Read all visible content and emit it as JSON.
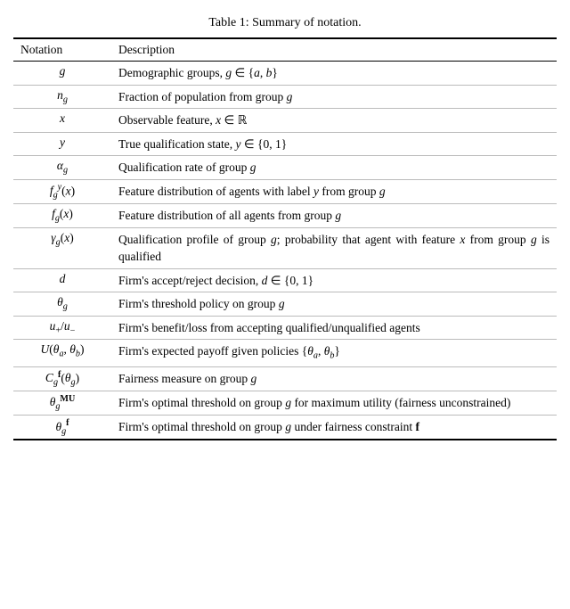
{
  "title": "Table 1: Summary of notation.",
  "columns": [
    "Notation",
    "Description"
  ],
  "rows": [
    {
      "notation_html": "<i>g</i>",
      "description_html": "Demographic groups, <i>g</i> ∈ {<i>a</i>, <i>b</i>}"
    },
    {
      "notation_html": "<i>n<sub>g</sub></i>",
      "description_html": "Fraction of population from group <i>g</i>"
    },
    {
      "notation_html": "<i>x</i>",
      "description_html": "Observable feature, <i>x</i> ∈ ℝ"
    },
    {
      "notation_html": "<i>y</i>",
      "description_html": "True qualification state, <i>y</i> ∈ {0, 1}"
    },
    {
      "notation_html": "<i>α<sub>g</sub></i>",
      "description_html": "Qualification rate of group <i>g</i>"
    },
    {
      "notation_html": "<i>f<sub>g</sub><sup>y</sup></i>(<i>x</i>)",
      "description_html": "Feature distribution of agents with label <i>y</i> from group <i>g</i>"
    },
    {
      "notation_html": "<i>f<sub>g</sub></i>(<i>x</i>)",
      "description_html": "Feature distribution of all agents from group <i>g</i>"
    },
    {
      "notation_html": "<i>γ<sub>g</sub></i>(<i>x</i>)",
      "description_html": "Qualification profile of group <i>g</i>; probability that agent with feature <i>x</i> from group <i>g</i> is qualified"
    },
    {
      "notation_html": "<i>d</i>",
      "description_html": "Firm's accept/reject decision, <i>d</i> ∈ {0, 1}"
    },
    {
      "notation_html": "<i>θ<sub>g</sub></i>",
      "description_html": "Firm's threshold policy on group <i>g</i>"
    },
    {
      "notation_html": "<i>u</i><sub>+</sub>/<i>u</i><sub>−</sub>",
      "description_html": "Firm's benefit/loss from accepting qualified/unqualified agents"
    },
    {
      "notation_html": "<i>U</i>(<i>θ<sub>a</sub></i>, <i>θ<sub>b</sub></i>)",
      "description_html": "Firm's expected payoff given policies {<i>θ<sub>a</sub></i>, <i>θ<sub>b</sub></i>}"
    },
    {
      "notation_html": "<i>C<sub>g</sub></i><sup><b>f</b></sup>(<i>θ<sub>g</sub></i>)",
      "description_html": "Fairness measure on group <i>g</i>"
    },
    {
      "notation_html": "<i>θ<sub>g</sub></i><sup><b>MU</b></sup>",
      "description_html": "Firm's optimal threshold on group <i>g</i> for maximum utility (fairness unconstrained)"
    },
    {
      "notation_html": "<i>θ<sub>g</sub></i><sup><b>f</b></sup>",
      "description_html": "Firm's optimal threshold on group <i>g</i> under fairness constraint <b>f</b>"
    }
  ]
}
